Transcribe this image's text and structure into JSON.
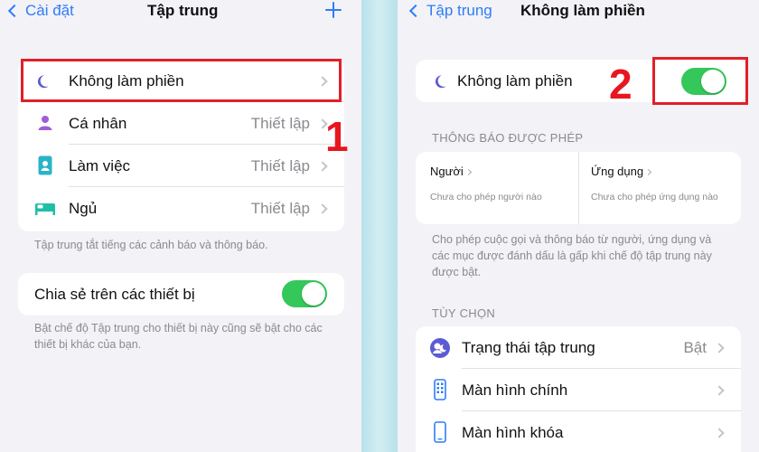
{
  "left": {
    "back_label": "Cài đặt",
    "title": "Tập trung",
    "focus_modes": [
      {
        "label": "Không làm phiền",
        "value": "",
        "icon": "moon-icon"
      },
      {
        "label": "Cá nhân",
        "value": "Thiết lập",
        "icon": "person-icon"
      },
      {
        "label": "Làm việc",
        "value": "Thiết lập",
        "icon": "id-badge-icon"
      },
      {
        "label": "Ngủ",
        "value": "Thiết lập",
        "icon": "bed-icon"
      }
    ],
    "focus_note": "Tập trung tắt tiếng các cảnh báo và thông báo.",
    "share_label": "Chia sẻ trên các thiết bị",
    "share_note": "Bật chế độ Tập trung cho thiết bị này cũng sẽ bật cho các thiết bị khác của bạn.",
    "step_label": "1"
  },
  "right": {
    "back_label": "Tập trung",
    "title": "Không làm phiền",
    "mode_label": "Không làm phiền",
    "step_label": "2",
    "allowed_header": "THÔNG BÁO ĐƯỢC PHÉP",
    "allowed": [
      {
        "title": "Người",
        "subtitle": "Chưa cho phép người nào"
      },
      {
        "title": "Ứng dụng",
        "subtitle": "Chưa cho phép ứng dụng nào"
      }
    ],
    "allowed_note": "Cho phép cuộc gọi và thông báo từ người, ứng dụng và các mục được đánh dấu là gấp khi chế độ tập trung này được bật.",
    "options_header": "TÙY CHỌN",
    "options": [
      {
        "label": "Trạng thái tập trung",
        "value": "Bật",
        "icon": "focus-status-icon"
      },
      {
        "label": "Màn hình chính",
        "value": "",
        "icon": "home-screen-icon"
      },
      {
        "label": "Màn hình khóa",
        "value": "",
        "icon": "lock-screen-icon"
      }
    ]
  },
  "colors": {
    "accent": "#2f7cf6",
    "toggle_on": "#34c759",
    "highlight_red": "#e0202a",
    "moon": "#5b5bd6",
    "person": "#a05ed6",
    "work": "#2ab3c7",
    "sleep": "#1fbfa6"
  }
}
